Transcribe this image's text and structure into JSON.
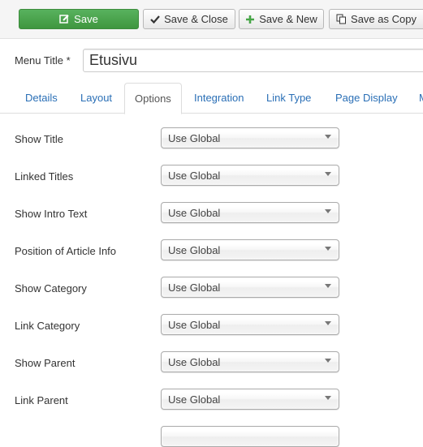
{
  "toolbar": {
    "save_label": "Save",
    "save_close_label": "Save & Close",
    "save_new_label": "Save & New",
    "save_copy_label": "Save as Copy"
  },
  "title": {
    "label": "Menu Title *",
    "value": "Etusivu"
  },
  "tabs": [
    {
      "label": "Details"
    },
    {
      "label": "Layout"
    },
    {
      "label": "Options"
    },
    {
      "label": "Integration"
    },
    {
      "label": "Link Type"
    },
    {
      "label": "Page Display"
    },
    {
      "label": "M"
    }
  ],
  "active_tab": "Options",
  "options": [
    {
      "label": "Show Title",
      "value": "Use Global"
    },
    {
      "label": "Linked Titles",
      "value": "Use Global"
    },
    {
      "label": "Show Intro Text",
      "value": "Use Global"
    },
    {
      "label": "Position of Article Info",
      "value": "Use Global"
    },
    {
      "label": "Show Category",
      "value": "Use Global"
    },
    {
      "label": "Link Category",
      "value": "Use Global"
    },
    {
      "label": "Show Parent",
      "value": "Use Global"
    },
    {
      "label": "Link Parent",
      "value": "Use Global"
    }
  ],
  "colors": {
    "primary_green": "#46a546",
    "link_blue": "#2a6fb6"
  },
  "icons": {
    "save": "pencil-square-icon",
    "save_close": "checkmark-icon",
    "save_new": "plus-icon",
    "save_copy": "copy-icon",
    "select_arrow": "caret-down-icon"
  }
}
